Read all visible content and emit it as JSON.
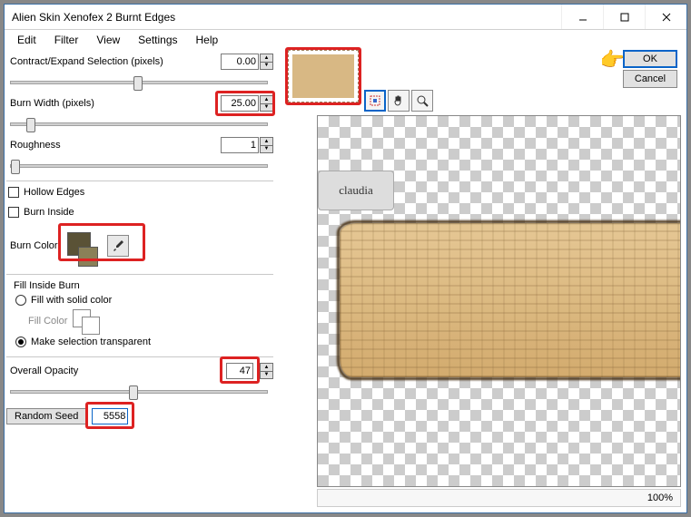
{
  "window": {
    "title": "Alien Skin Xenofex 2 Burnt Edges"
  },
  "menu": {
    "edit": "Edit",
    "filter": "Filter",
    "view": "View",
    "settings": "Settings",
    "help": "Help"
  },
  "params": {
    "contract_label": "Contract/Expand Selection (pixels)",
    "contract_value": "0.00",
    "burnwidth_label": "Burn Width (pixels)",
    "burnwidth_value": "25.00",
    "roughness_label": "Roughness",
    "roughness_value": "1",
    "hollow_edges": "Hollow Edges",
    "burn_inside": "Burn Inside",
    "burn_color_label": "Burn Color",
    "fill_inside_label": "Fill Inside Burn",
    "fill_solid_label": "Fill with solid color",
    "fill_color_label": "Fill Color",
    "make_transparent_label": "Make selection transparent",
    "overall_opacity_label": "Overall Opacity",
    "overall_opacity_value": "47",
    "random_seed_btn": "Random Seed",
    "random_seed_value": "5558"
  },
  "colors": {
    "burn_primary": "#5a5236",
    "burn_secondary": "#8a8058"
  },
  "buttons": {
    "ok": "OK",
    "cancel": "Cancel"
  },
  "status": {
    "zoom": "100%"
  },
  "watermark": "claudia"
}
